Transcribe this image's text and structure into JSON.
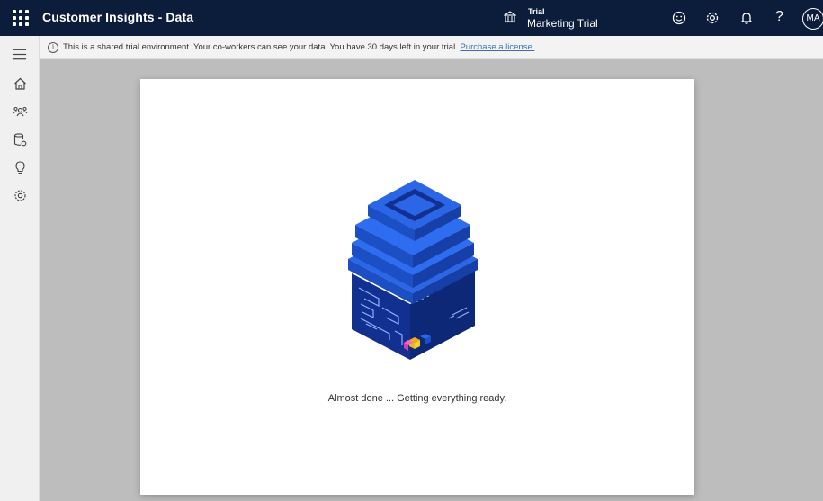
{
  "header": {
    "app_title": "Customer Insights - Data",
    "environment_type": "Trial",
    "environment_name": "Marketing Trial",
    "avatar_initials": "MA",
    "help_glyph": "?",
    "icons": [
      "waffle-icon",
      "environment-icon",
      "smiley-icon",
      "gear-icon",
      "bell-icon",
      "help-icon"
    ]
  },
  "notice": {
    "text": "This is a shared trial environment. Your co-workers can see your data. You have 30 days left in your trial.",
    "link_label": "Purchase a license.",
    "info_glyph": "i"
  },
  "sidebar": {
    "items": [
      {
        "icon": "hamburger-icon"
      },
      {
        "icon": "home-icon"
      },
      {
        "icon": "people-icon"
      },
      {
        "icon": "database-icon"
      },
      {
        "icon": "lightbulb-icon"
      },
      {
        "icon": "settings-icon"
      }
    ]
  },
  "dialog": {
    "status": "Almost done ... Getting everything ready."
  },
  "colors": {
    "topbar": "#0b1d3a",
    "building_light": "#2a66e6",
    "building_dark": "#12308f",
    "link": "#3a6fb5"
  }
}
